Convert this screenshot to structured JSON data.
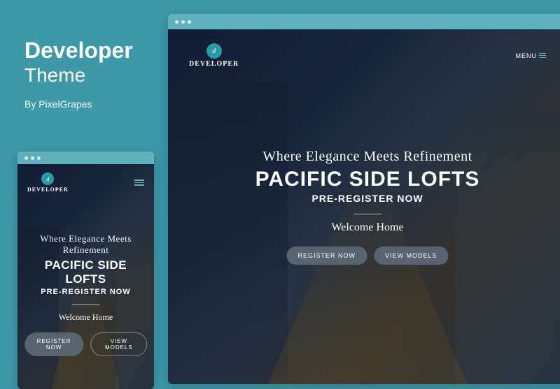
{
  "heading": {
    "title": "Developer",
    "subtitle": "Theme",
    "byline": "By PixelGrapes"
  },
  "preview": {
    "logo_initial": "d",
    "logo_text": "DEVELOPER",
    "menu_label": "MENU",
    "tagline": "Where Elegance Meets Refinement",
    "hero_title": "PACIFIC SIDE LOFTS",
    "hero_sub": "PRE-REGISTER NOW",
    "welcome": "Welcome Home",
    "btn_register": "REGISTER NOW",
    "btn_models": "VIEW MODELS"
  }
}
